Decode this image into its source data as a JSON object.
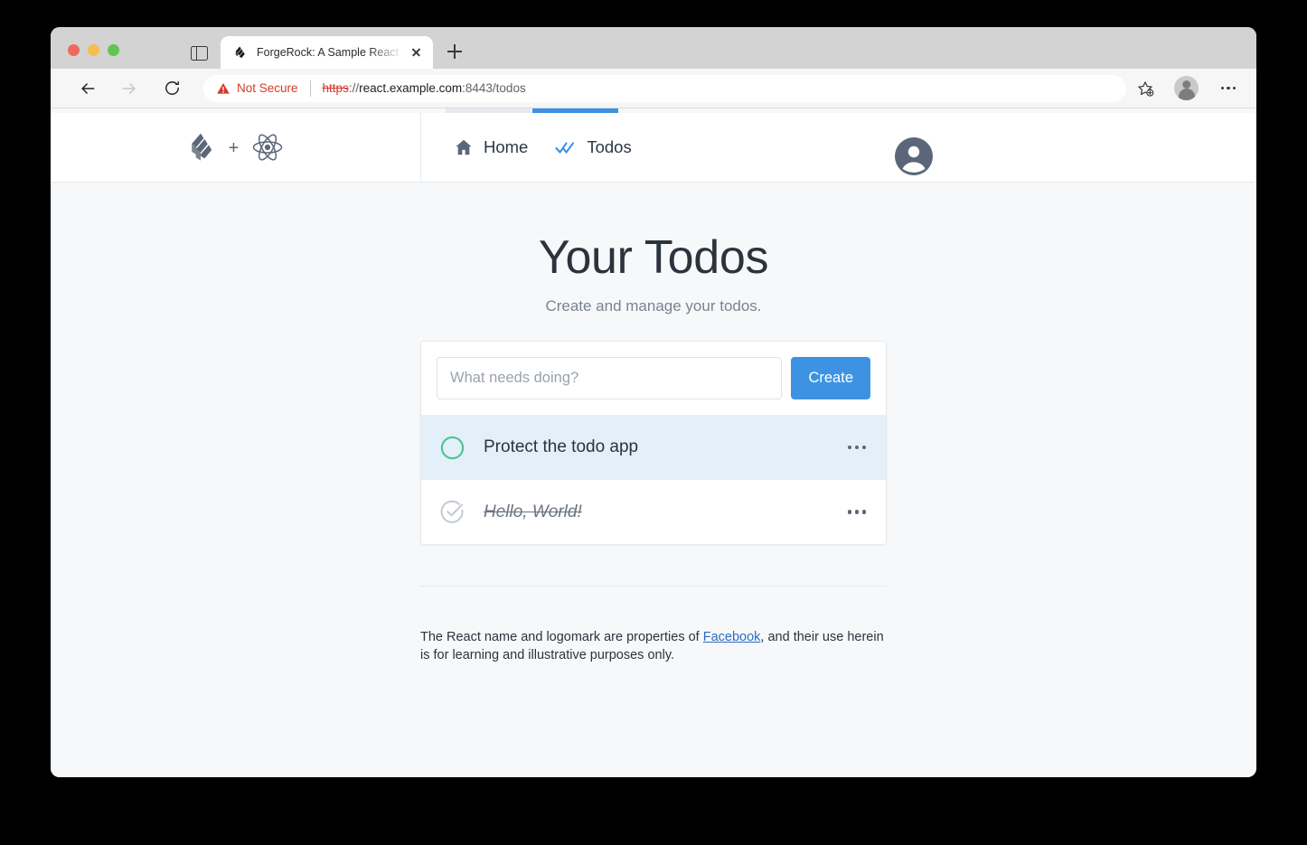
{
  "browser": {
    "tab": {
      "title": "ForgeRock: A Sample React (W",
      "favicon_icon": "forgerock-logo-icon",
      "close_icon": "close-icon"
    },
    "new_tab_icon": "plus-icon",
    "sidebar_toggle_icon": "sidebar-panel-icon",
    "toolbar": {
      "back_icon": "arrow-left-icon",
      "forward_icon": "arrow-right-icon",
      "reload_icon": "reload-icon",
      "security_warning_icon": "warning-triangle-icon",
      "security_label": "Not Secure",
      "url": {
        "scheme": "https",
        "separator": "://",
        "host": "react.example.com",
        "rest": ":8443/todos",
        "full": "https://react.example.com:8443/todos"
      },
      "bookmark_icon": "star-plus-icon",
      "profile_icon": "account-avatar-icon",
      "menu_icon": "three-dots-vertical-icon"
    },
    "traffic_lights": {
      "close": "#ed6a5e",
      "minimize": "#f4bf4f",
      "maximize": "#61c554"
    }
  },
  "app": {
    "brand": {
      "forgerock_icon": "forgerock-logo-icon",
      "plus": "+",
      "react_icon": "react-atom-logo-icon"
    },
    "nav": [
      {
        "label": "Home",
        "icon": "home-icon",
        "active": false
      },
      {
        "label": "Todos",
        "icon": "double-check-icon",
        "active": true
      }
    ],
    "avatar_icon": "account-circle-icon"
  },
  "main": {
    "title": "Your Todos",
    "subtitle": "Create and manage your todos.",
    "create": {
      "placeholder": "What needs doing?",
      "value": "",
      "button_label": "Create"
    },
    "todos": [
      {
        "label": "Protect the todo app",
        "completed": false,
        "highlighted": true,
        "toggle_icon": "circle-outline-icon",
        "menu_icon": "three-dots-horizontal-icon"
      },
      {
        "label": "Hello, World!",
        "completed": true,
        "highlighted": false,
        "toggle_icon": "check-circle-icon",
        "menu_icon": "three-dots-horizontal-icon"
      }
    ]
  },
  "footer": {
    "text_before": "The React name and logomark are properties of ",
    "link_label": "Facebook",
    "text_after": ", and their use herein is for learning and illustrative purposes only."
  },
  "colors": {
    "accent_blue": "#3d93e2",
    "incomplete_green": "#4ec292",
    "complete_gray": "#c2c8d0",
    "danger_red": "#d43a28",
    "slate": "#5b6779",
    "page_bg": "#f7f8fa"
  }
}
